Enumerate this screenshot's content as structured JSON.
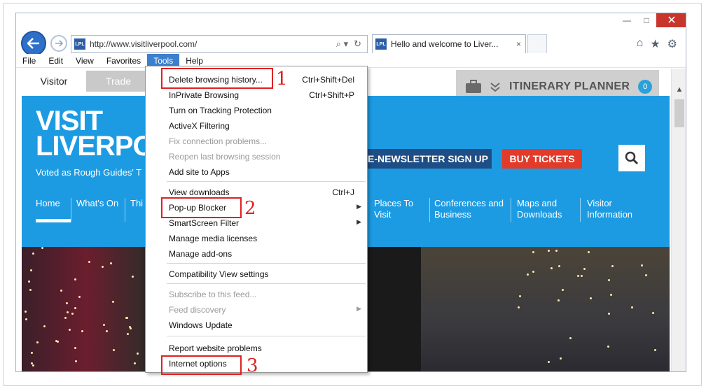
{
  "browser": {
    "url": "http://www.visitliverpool.com/",
    "favicon_text": "LPL",
    "tab_title": "Hello and welcome to Liver...",
    "tab_close": "×",
    "window_minimize": "—",
    "window_maximize": "□",
    "window_close": "✕",
    "menu": [
      "File",
      "Edit",
      "View",
      "Favorites",
      "Tools",
      "Help"
    ],
    "active_menu": "Tools"
  },
  "page": {
    "audience_tabs": [
      "Visitor",
      "Trade"
    ],
    "itinerary_label": "ITINERARY PLANNER",
    "itinerary_count": "0",
    "logo_line1": "VISIT",
    "logo_line2": "LIVERPO",
    "tagline": "Voted as Rough Guides' T",
    "newsletter": "E-NEWSLETTER SIGN UP",
    "tickets": "BUY TICKETS",
    "nav": {
      "home": "Home",
      "whats_on": "What's On",
      "things": "Thi",
      "places_1": "Places To",
      "places_2": "Visit",
      "conf_1": "Conferences and",
      "conf_2": "Business",
      "maps_1": "Maps and",
      "maps_2": "Downloads",
      "visitor_1": "Visitor",
      "visitor_2": "Information"
    }
  },
  "tools_menu": {
    "items": [
      {
        "label": "Delete browsing history...",
        "shortcut": "Ctrl+Shift+Del"
      },
      {
        "label": "InPrivate Browsing",
        "shortcut": "Ctrl+Shift+P"
      },
      {
        "label": "Turn on Tracking Protection",
        "shortcut": ""
      },
      {
        "label": "ActiveX Filtering",
        "shortcut": ""
      },
      {
        "label": "Fix connection problems...",
        "shortcut": ""
      },
      {
        "label": "Reopen last browsing session",
        "shortcut": ""
      },
      {
        "label": "Add site to Apps",
        "shortcut": ""
      },
      {
        "label": "View downloads",
        "shortcut": "Ctrl+J"
      },
      {
        "label": "Pop-up Blocker",
        "shortcut": ""
      },
      {
        "label": "SmartScreen Filter",
        "shortcut": ""
      },
      {
        "label": "Manage media licenses",
        "shortcut": ""
      },
      {
        "label": "Manage add-ons",
        "shortcut": ""
      },
      {
        "label": "Compatibility View settings",
        "shortcut": ""
      },
      {
        "label": "Subscribe to this feed...",
        "shortcut": ""
      },
      {
        "label": "Feed discovery",
        "shortcut": ""
      },
      {
        "label": "Windows Update",
        "shortcut": ""
      },
      {
        "label": "Report website problems",
        "shortcut": ""
      },
      {
        "label": "Internet options",
        "shortcut": ""
      }
    ],
    "submenu_arrow": "▶"
  },
  "annotations": [
    "1",
    "2",
    "3"
  ],
  "colors": {
    "highlight_red": "#e02020",
    "site_blue": "#1d9be2",
    "ie_blue": "#2d6fc9"
  }
}
